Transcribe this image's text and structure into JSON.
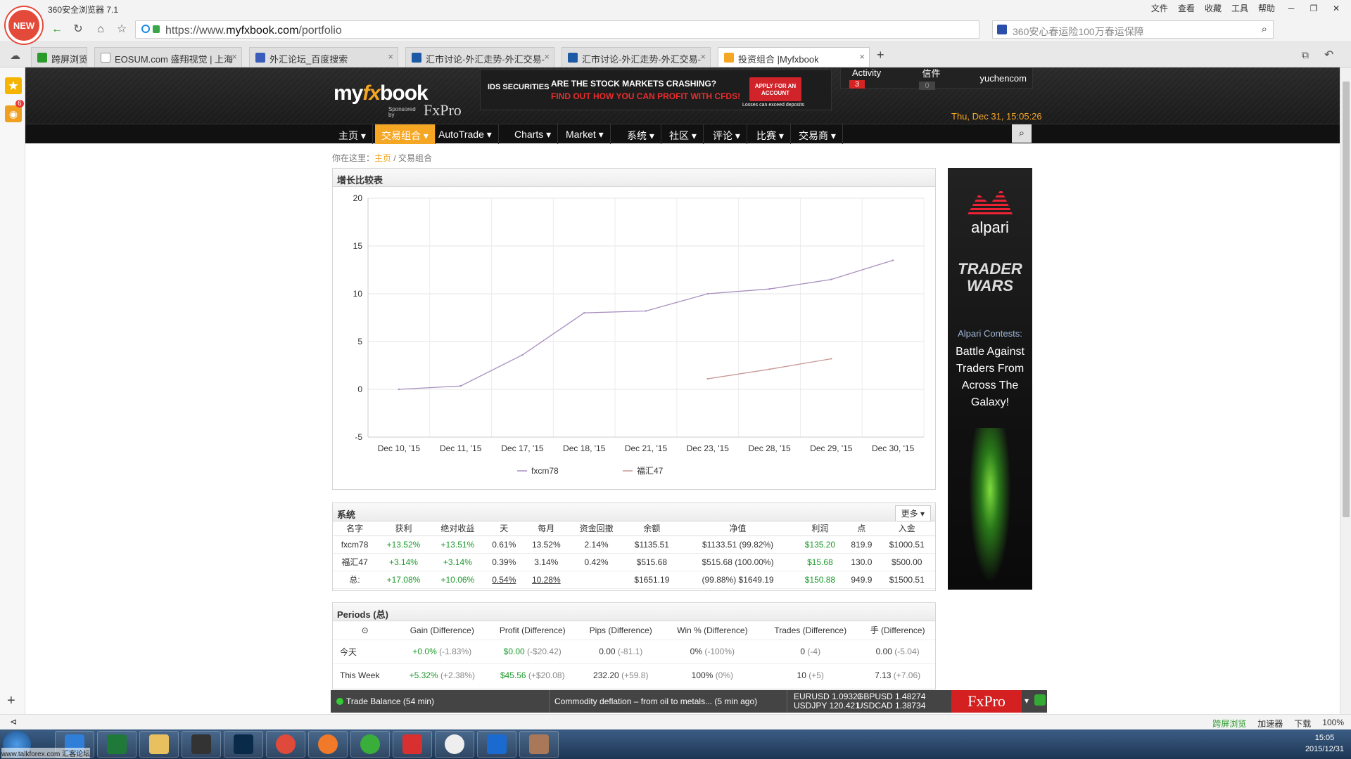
{
  "browser": {
    "new_badge": "NEW",
    "title": "360安全浏览器 7.1",
    "menu": [
      "文件",
      "查看",
      "收藏",
      "工具",
      "帮助"
    ],
    "url_prefix": "https://www.",
    "url_domain": "myfxbook.com",
    "url_path": "/portfolio",
    "search_placeholder": "360安心春运险100万春运保障",
    "tabs": [
      {
        "label": "跨屏浏览"
      },
      {
        "label": "EOSUM.com 盛翔视觉 | 上海"
      },
      {
        "label": "外汇论坛_百度搜索"
      },
      {
        "label": "汇市讨论-外汇走势-外汇交易-"
      },
      {
        "label": "汇市讨论-外汇走势-外汇交易-"
      },
      {
        "label": "投资组合 |Myfxbook"
      }
    ],
    "new_tab": "+",
    "weibo_count": "6"
  },
  "site": {
    "logo_my": "my",
    "logo_fx": "fx",
    "logo_book": "book",
    "logo_sponsored": "Sponsored by",
    "logo_fxpro": "FxPro",
    "banner": {
      "brand": "IDS SECURITIES",
      "line1": "ARE THE STOCK MARKETS CRASHING?",
      "line2": "FIND OUT HOW YOU CAN PROFIT WITH CFDS!",
      "apply": "APPLY FOR AN ACCOUNT",
      "disclaimer": "Losses can exceed deposits"
    },
    "user": {
      "activity_label": "Activity",
      "activity_count": "3",
      "mail_label": "信件",
      "mail_count": "0",
      "username": "yuchencom"
    },
    "date": "Thu, Dec 31, 15:05:26",
    "nav": [
      "主页 ▾",
      "交易组合 ▾",
      "AutoTrade ▾",
      "Charts ▾",
      "Market ▾",
      "系统 ▾",
      "社区 ▾",
      "评论 ▾",
      "比赛 ▾",
      "交易商 ▾"
    ]
  },
  "breadcrumb": {
    "prefix": "你在这里：",
    "home": "主页",
    "sep": " / ",
    "current": "交易组合"
  },
  "chart_panel": {
    "title": "增长比较表"
  },
  "chart_data": {
    "type": "line",
    "title": "增长比较表",
    "categories": [
      "Dec 10, '15",
      "Dec 11, '15",
      "Dec 17, '15",
      "Dec 18, '15",
      "Dec 21, '15",
      "Dec 23, '15",
      "Dec 28, '15",
      "Dec 29, '15",
      "Dec 30, '15"
    ],
    "ylim": [
      -5,
      20
    ],
    "yticks": [
      20,
      15,
      10,
      5,
      0,
      -5
    ],
    "grid": true,
    "legend": "bottom",
    "series": [
      {
        "name": "fxcm78",
        "color": "#a88fc0",
        "points": [
          [
            0,
            0.0
          ],
          [
            1,
            0.35
          ],
          [
            2,
            3.6
          ],
          [
            3,
            8.0
          ],
          [
            4,
            8.2
          ],
          [
            5,
            10.0
          ],
          [
            6,
            10.5
          ],
          [
            7,
            11.5
          ],
          [
            8,
            13.5
          ]
        ]
      },
      {
        "name": "福汇47",
        "color": "#c89898",
        "points": [
          [
            5,
            1.1
          ],
          [
            6,
            2.1
          ],
          [
            7,
            3.2
          ]
        ]
      }
    ]
  },
  "systems": {
    "title": "系统",
    "more": "更多",
    "headers": [
      "名字",
      "获利",
      "绝对收益",
      "天",
      "每月",
      "资金回撤",
      "余额",
      "净值",
      "利润",
      "点",
      "入金"
    ],
    "rows": [
      [
        "fxcm78",
        "+13.52%",
        "+13.51%",
        "0.61%",
        "13.52%",
        "2.14%",
        "$1135.51",
        "$1133.51 (99.82%)",
        "$135.20",
        "819.9",
        "$1000.51"
      ],
      [
        "福汇47",
        "+3.14%",
        "+3.14%",
        "0.39%",
        "3.14%",
        "0.42%",
        "$515.68",
        "$515.68 (100.00%)",
        "$15.68",
        "130.0",
        "$500.00"
      ]
    ],
    "total": [
      "总:",
      "+17.08%",
      "+10.06%",
      "0.54%",
      "10.28%",
      "",
      "$1651.19",
      "(99.88%) $1649.19",
      "$150.88",
      "949.9",
      "$1500.51"
    ]
  },
  "periods": {
    "title": "Periods (总)",
    "help": "⊙",
    "headers": [
      "Gain (Difference)",
      "Profit (Difference)",
      "Pips (Difference)",
      "Win % (Difference)",
      "Trades (Difference)",
      "手 (Difference)"
    ],
    "rows": [
      {
        "label": "今天",
        "gain": "+0.0%",
        "gain_diff": "(-1.83%)",
        "profit": "$0.00",
        "profit_diff": "(-$20.42)",
        "pips": "0.00",
        "pips_diff": "(-81.1)",
        "win": "0%",
        "win_diff": "(-100%)",
        "trades": "0",
        "trades_diff": "(-4)",
        "lots": "0.00",
        "lots_diff": "(-5.04)"
      },
      {
        "label": "This Week",
        "gain": "+5.32%",
        "gain_diff": "(+2.38%)",
        "profit": "$45.56",
        "profit_diff": "(+$20.08)",
        "pips": "232.20",
        "pips_diff": "(+59.8)",
        "win": "100%",
        "win_diff": "(0%)",
        "trades": "10",
        "trades_diff": "(+5)",
        "lots": "7.13",
        "lots_diff": "(+7.06)"
      }
    ]
  },
  "ad": {
    "brand": "alpari",
    "headline": "TRADER WARS",
    "contest": "Alpari Contests:",
    "tagline": "Battle Against Traders From Across The Galaxy!"
  },
  "ticker": {
    "left": "Trade Balance (54 min)",
    "news": "Commodity deflation – from oil to metals...  (5 min ago)",
    "q1a": "EURUSD 1.09321",
    "q1b": "USDJPY  120.421",
    "q2a": "GBPUSD 1.48274",
    "q2b": "USDCAD 1.38734",
    "brand": "FxPro"
  },
  "statusbar": [
    "跨屏浏览",
    "加速器",
    "下载",
    "100%"
  ],
  "taskbar": {
    "time": "15:05",
    "date": "2015/12/31"
  },
  "watermark": "www.talkforex.com 汇客论坛"
}
